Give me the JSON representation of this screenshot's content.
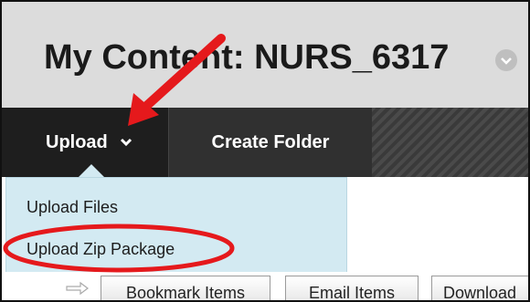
{
  "header": {
    "title": "My Content: NURS_6317"
  },
  "toolbar": {
    "upload_label": "Upload",
    "create_folder_label": "Create Folder"
  },
  "upload_menu": {
    "items": [
      {
        "label": "Upload Files"
      },
      {
        "label": "Upload Zip Package"
      }
    ]
  },
  "action_bar": {
    "bookmark_label": "Bookmark Items",
    "email_label": "Email Items",
    "download_label": "Download"
  },
  "colors": {
    "header_bg": "#dcdcdc",
    "toolbar_bg": "#2a2a2a",
    "menu_bg": "#d3eaf2",
    "annotation_red": "#e5191c"
  },
  "icons": {
    "upload_chevron": "chevron-down-icon",
    "title_chevron": "chevron-down-circle-icon",
    "action_arrow": "arrow-right-icon"
  }
}
